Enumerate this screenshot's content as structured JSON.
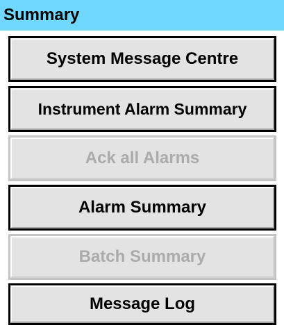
{
  "header": {
    "title": "Summary"
  },
  "buttons": [
    {
      "label": "System Message Centre",
      "enabled": true
    },
    {
      "label": "Instrument Alarm Summary",
      "enabled": true
    },
    {
      "label": "Ack all Alarms",
      "enabled": false
    },
    {
      "label": "Alarm Summary",
      "enabled": true
    },
    {
      "label": "Batch Summary",
      "enabled": false
    },
    {
      "label": "Message Log",
      "enabled": true
    }
  ],
  "colors": {
    "header_background": "#70d8ff",
    "button_background": "#e3e3e3",
    "enabled_text": "#000000",
    "disabled_text": "#ababab"
  }
}
